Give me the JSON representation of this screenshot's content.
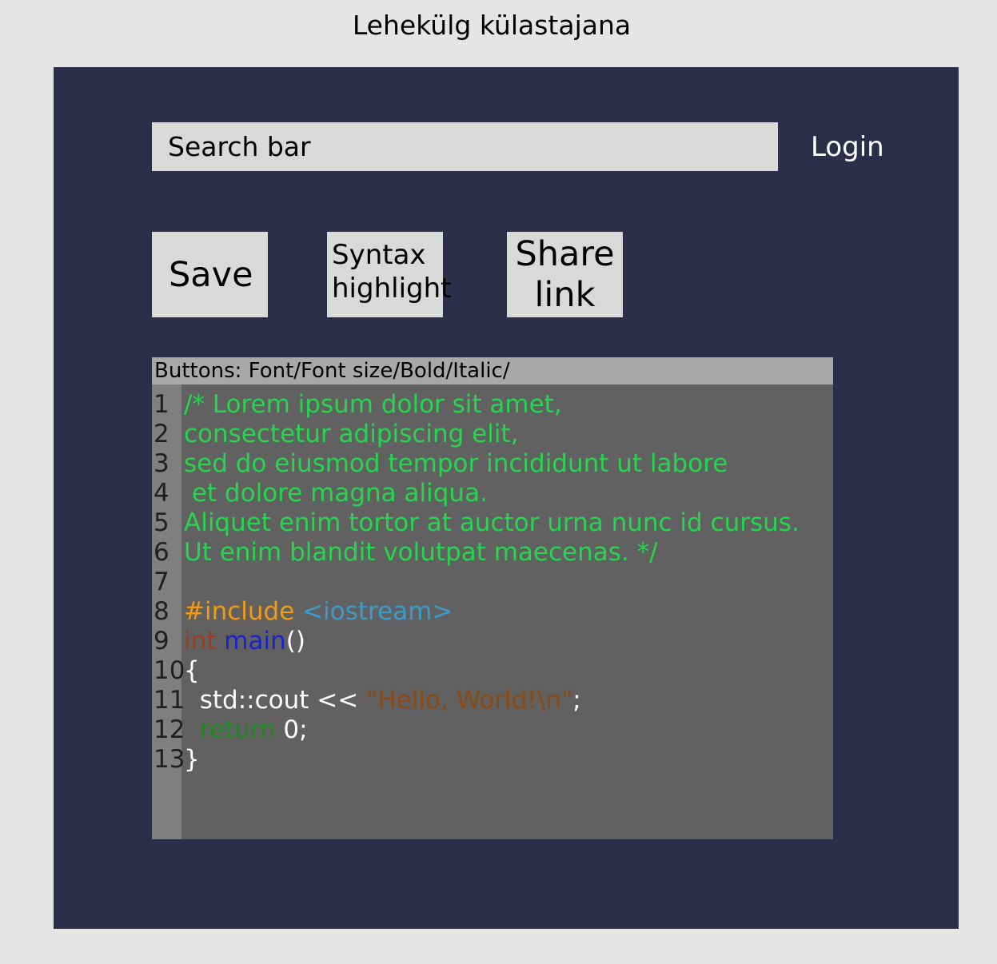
{
  "page": {
    "title": "Lehekülg külastajana"
  },
  "header": {
    "search_placeholder": "Search bar",
    "login_label": "Login"
  },
  "toolbar": {
    "save_label": "Save",
    "syntax_label": "Syntax\nhighlight",
    "share_label": "Share\nlink"
  },
  "editor": {
    "format_bar_label": "Buttons: Font/Font size/Bold/Italic/",
    "lines": [
      {
        "number": "1",
        "tokens": [
          {
            "text": "/* Lorem ipsum dolor sit amet,",
            "color": "#26d64e"
          }
        ]
      },
      {
        "number": "2",
        "tokens": [
          {
            "text": "consectetur adipiscing elit,",
            "color": "#26d64e"
          }
        ]
      },
      {
        "number": "3",
        "tokens": [
          {
            "text": "sed do eiusmod tempor incididunt ut labore",
            "color": "#26d64e"
          }
        ]
      },
      {
        "number": "4",
        "tokens": [
          {
            "text": " et dolore magna aliqua.",
            "color": "#26d64e"
          }
        ]
      },
      {
        "number": "5",
        "tokens": [
          {
            "text": "Aliquet enim tortor at auctor urna nunc id cursus.",
            "color": "#26d64e"
          }
        ]
      },
      {
        "number": "6",
        "tokens": [
          {
            "text": "Ut enim blandit volutpat maecenas. */",
            "color": "#26d64e"
          }
        ]
      },
      {
        "number": "7",
        "tokens": []
      },
      {
        "number": "8",
        "tokens": [
          {
            "text": "#include",
            "color": "#f39a12"
          },
          {
            "text": " ",
            "color": "#ffffff"
          },
          {
            "text": "<iostream>",
            "color": "#3b9ccc"
          }
        ]
      },
      {
        "number": "9",
        "tokens": [
          {
            "text": "int",
            "color": "#a13a17"
          },
          {
            "text": " ",
            "color": "#ffffff"
          },
          {
            "text": "main",
            "color": "#1a22cc"
          },
          {
            "text": "()",
            "color": "#ffffff"
          }
        ]
      },
      {
        "number": "10",
        "tokens": [
          {
            "text": "{",
            "color": "#ffffff"
          }
        ]
      },
      {
        "number": "11",
        "tokens": [
          {
            "text": "  std::cout << ",
            "color": "#ffffff"
          },
          {
            "text": "\"Hello, World!\\n\"",
            "color": "#8a4a12"
          },
          {
            "text": ";",
            "color": "#ffffff"
          }
        ]
      },
      {
        "number": "12",
        "tokens": [
          {
            "text": "  ",
            "color": "#ffffff"
          },
          {
            "text": "return",
            "color": "#1f8a24"
          },
          {
            "text": " 0;",
            "color": "#ffffff"
          }
        ]
      },
      {
        "number": "13",
        "tokens": [
          {
            "text": "}",
            "color": "#ffffff"
          }
        ]
      }
    ]
  }
}
